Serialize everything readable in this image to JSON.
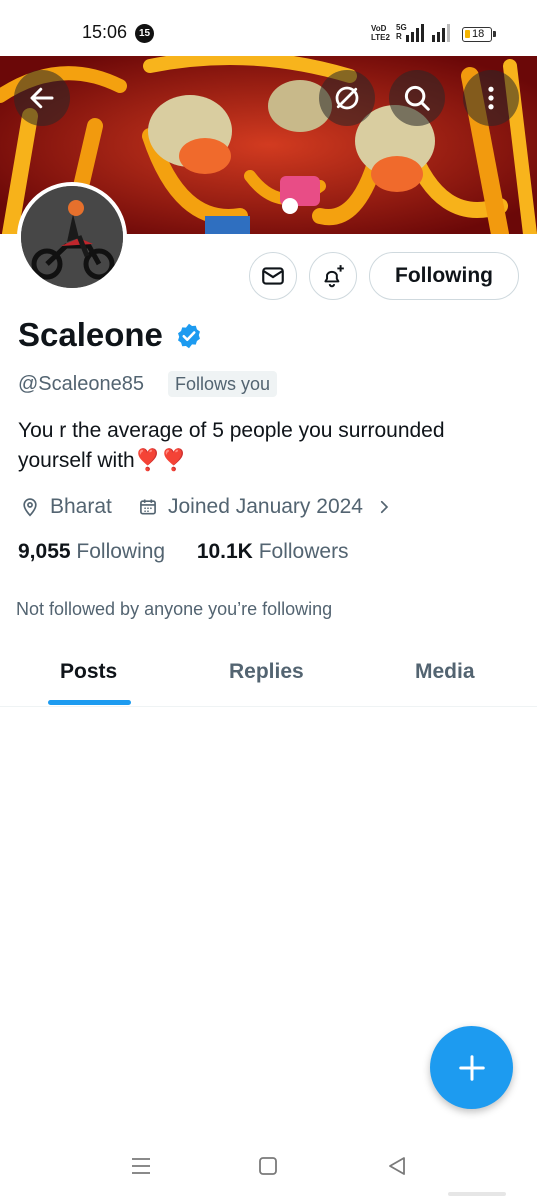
{
  "status_bar": {
    "time": "15:06",
    "notification_count": "15",
    "volte_label_1": "VoD",
    "volte_label_2": "LTE2",
    "net_label_1": "5G",
    "net_label_2": "R",
    "battery": "18"
  },
  "header": {
    "back_icon": "arrow-left-icon",
    "grok_icon": "grok-icon",
    "search_icon": "search-icon",
    "more_icon": "more-vertical-icon"
  },
  "profile": {
    "display_name": "Scaleone",
    "verified": true,
    "handle": "@Scaleone85",
    "follows_you": "Follows you",
    "bio": "You r the average of 5 people you surrounded yourself with",
    "bio_emoji": "❣️❣️",
    "location": "Bharat",
    "joined": "Joined January 2024",
    "following_count": "9,055",
    "following_label": "Following",
    "followers_count": "10.1K",
    "followers_label": "Followers",
    "not_followed_note": "Not followed by anyone you’re following"
  },
  "actions": {
    "message_icon": "envelope-icon",
    "notify_icon": "bell-plus-icon",
    "following_button": "Following"
  },
  "tabs": [
    {
      "label": "Posts",
      "active": true
    },
    {
      "label": "Replies",
      "active": false
    },
    {
      "label": "Media",
      "active": false
    }
  ],
  "fab_icon": "plus-icon",
  "colors": {
    "accent": "#1d9bf0",
    "text_primary": "#0f1419",
    "text_secondary": "#536471"
  }
}
